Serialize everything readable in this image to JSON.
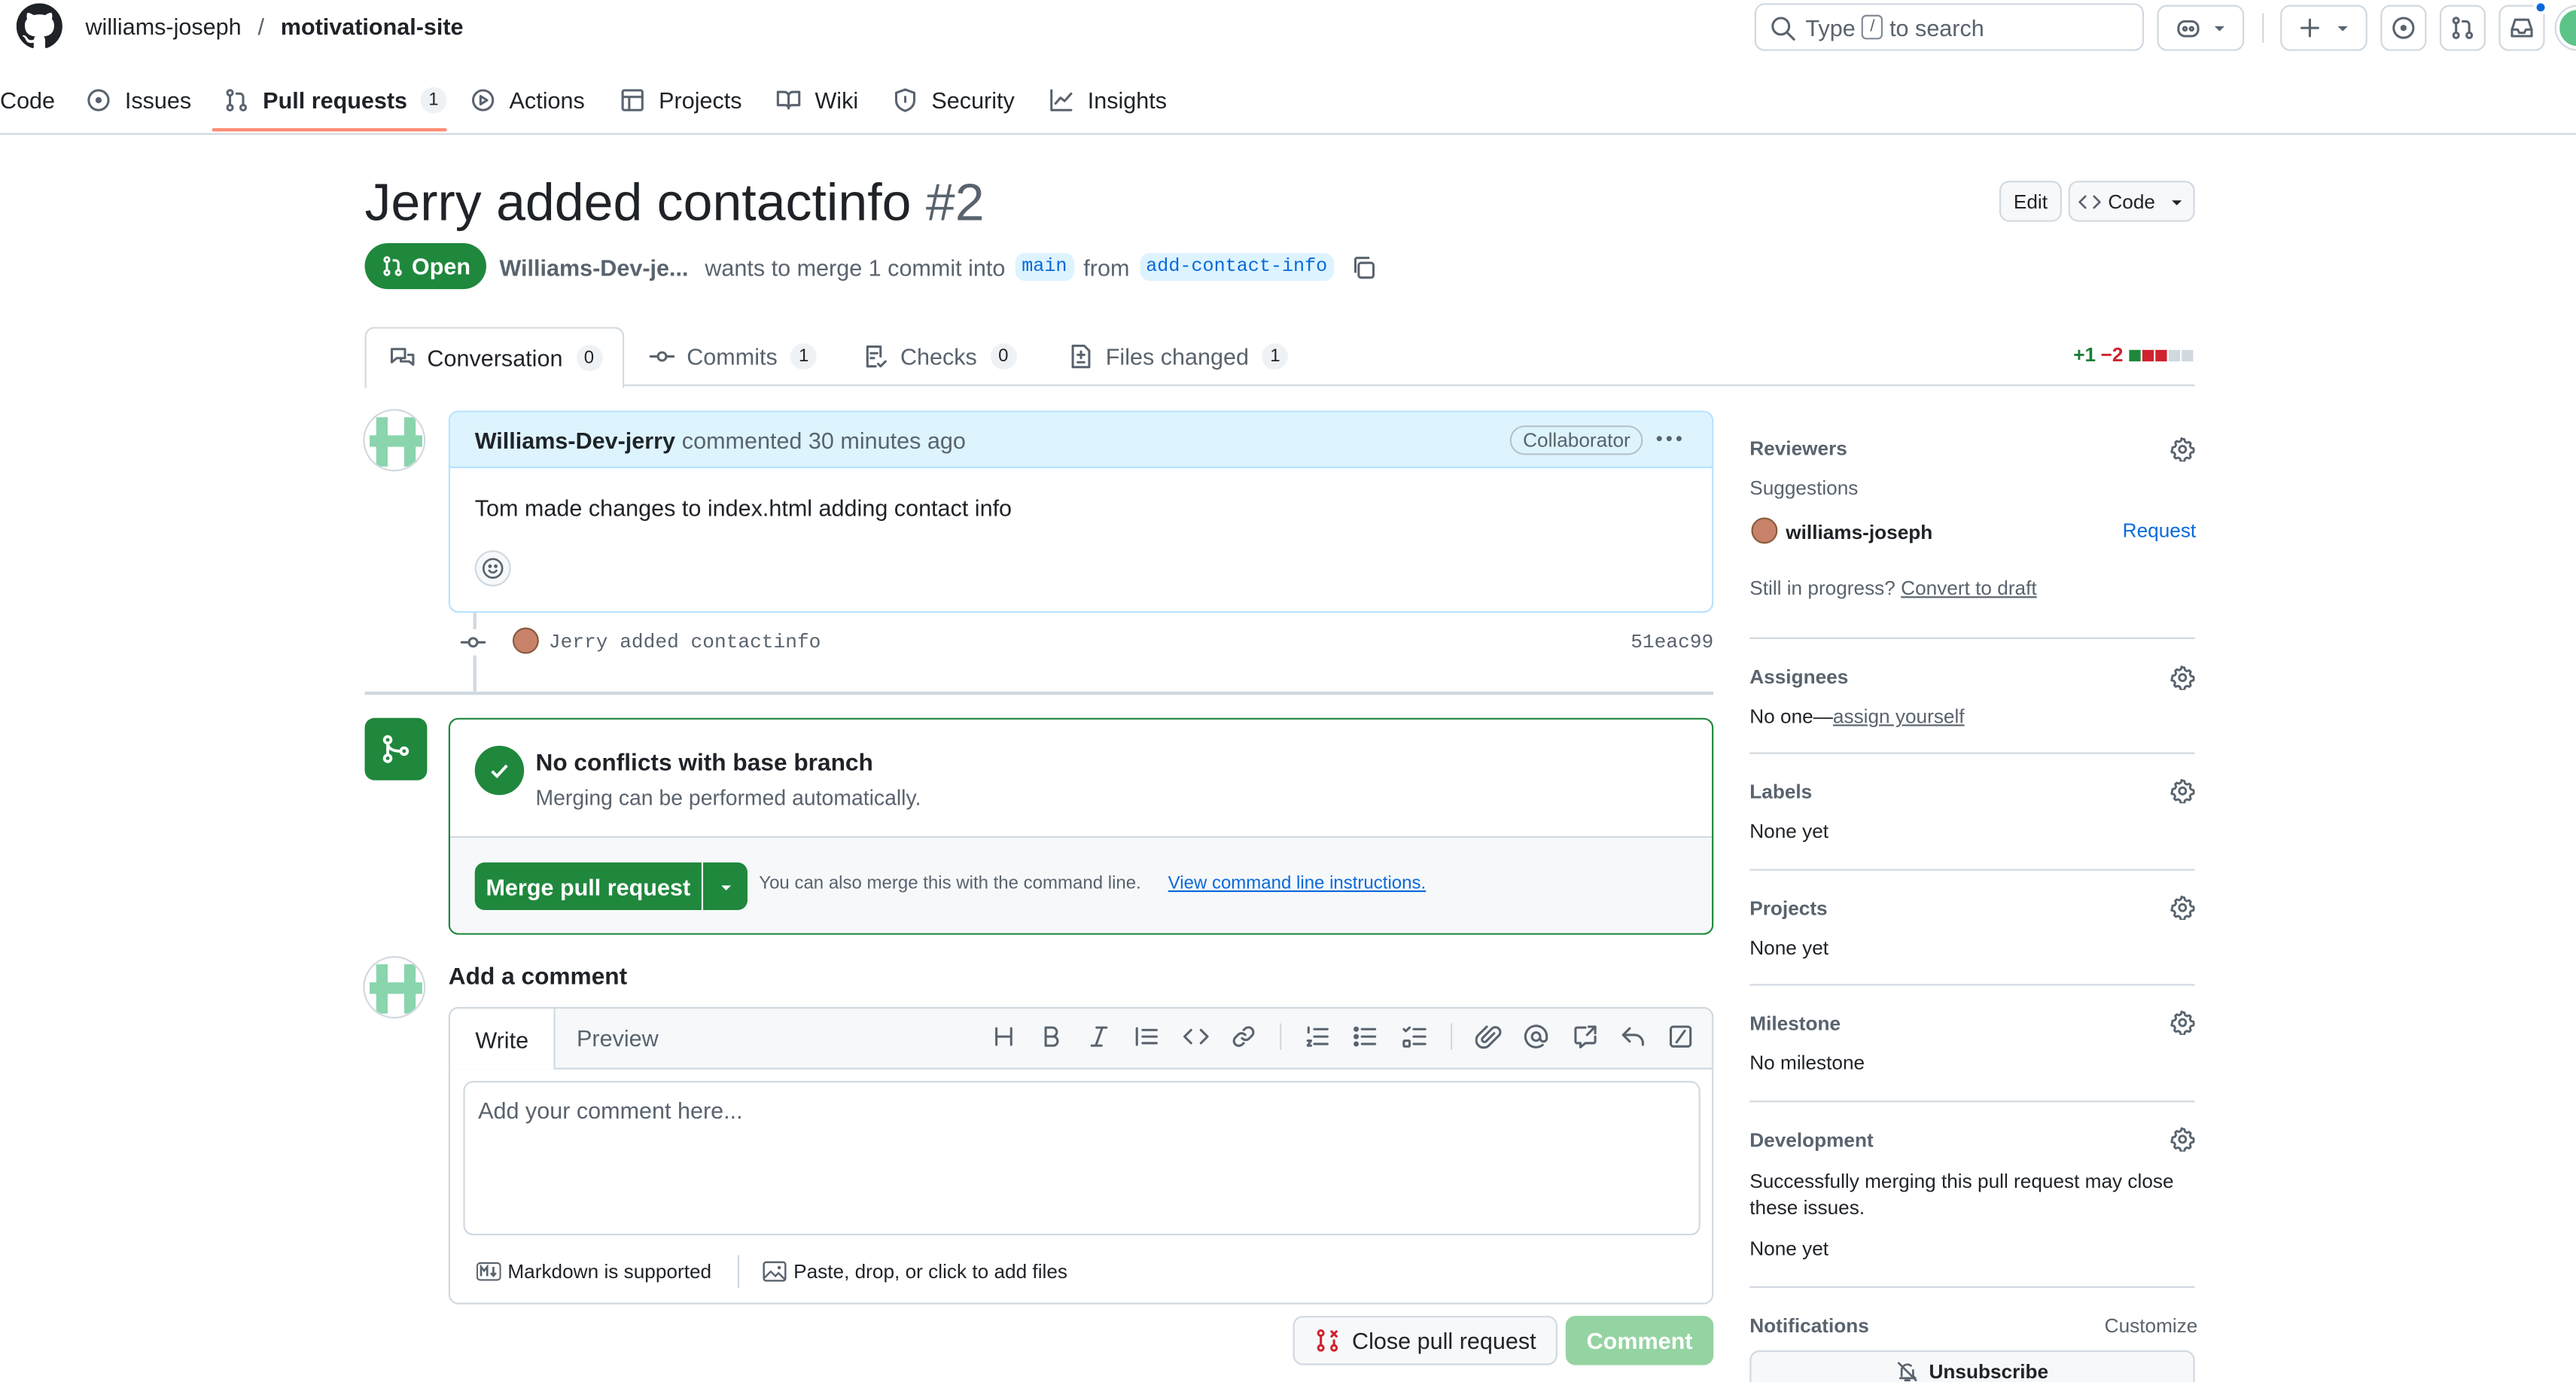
{
  "header": {
    "owner": "williams-joseph",
    "separator": "/",
    "repo": "motivational-site",
    "search_prefix": "Type",
    "search_key": "/",
    "search_suffix": "to search"
  },
  "repo_nav": {
    "code": "Code",
    "issues": "Issues",
    "pull_requests": "Pull requests",
    "pull_requests_count": "1",
    "actions": "Actions",
    "projects": "Projects",
    "wiki": "Wiki",
    "security": "Security",
    "insights": "Insights"
  },
  "pr": {
    "title": "Jerry added contactinfo",
    "number": "#2",
    "edit_label": "Edit",
    "code_label": "Code",
    "state": "Open",
    "author": "Williams-Dev-je...",
    "merge_text": "wants to merge 1 commit into",
    "base_branch": "main",
    "from_text": "from",
    "head_branch": "add-contact-info"
  },
  "tabs": {
    "conversation": "Conversation",
    "conversation_count": "0",
    "commits": "Commits",
    "commits_count": "1",
    "checks": "Checks",
    "checks_count": "0",
    "files": "Files changed",
    "files_count": "1",
    "additions": "+1",
    "deletions": "−2"
  },
  "comment": {
    "author": "Williams-Dev-jerry",
    "meta": "commented 30 minutes ago",
    "badge": "Collaborator",
    "body": "Tom made changes to index.html adding contact info"
  },
  "commit": {
    "message": "Jerry added contactinfo",
    "sha": "51eac99"
  },
  "merge": {
    "title": "No conflicts with base branch",
    "subtitle": "Merging can be performed automatically.",
    "button": "Merge pull request",
    "hint": "You can also merge this with the command line.",
    "link": "View command line instructions."
  },
  "add_comment": {
    "heading": "Add a comment",
    "write_tab": "Write",
    "preview_tab": "Preview",
    "placeholder": "Add your comment here...",
    "markdown_note": "Markdown is supported",
    "files_note": "Paste, drop, or click to add files",
    "close_button": "Close pull request",
    "comment_button": "Comment"
  },
  "sidebar": {
    "reviewers_title": "Reviewers",
    "suggestions": "Suggestions",
    "suggested_reviewer": "williams-joseph",
    "request": "Request",
    "in_progress": "Still in progress?",
    "convert_draft": "Convert to draft",
    "assignees_title": "Assignees",
    "assignees_none": "No one—",
    "assign_yourself": "assign yourself",
    "labels_title": "Labels",
    "labels_value": "None yet",
    "projects_title": "Projects",
    "projects_value": "None yet",
    "milestone_title": "Milestone",
    "milestone_value": "No milestone",
    "development_title": "Development",
    "development_text": "Successfully merging this pull request may close these issues.",
    "development_value": "None yet",
    "notifications_title": "Notifications",
    "customize": "Customize",
    "unsubscribe": "Unsubscribe"
  },
  "colors": {
    "green": "#1f883d",
    "merge_green": "#2da44e",
    "link_blue": "#0969da",
    "danger_red": "#cf222e",
    "comment_header_bg": "#ddf4ff"
  }
}
